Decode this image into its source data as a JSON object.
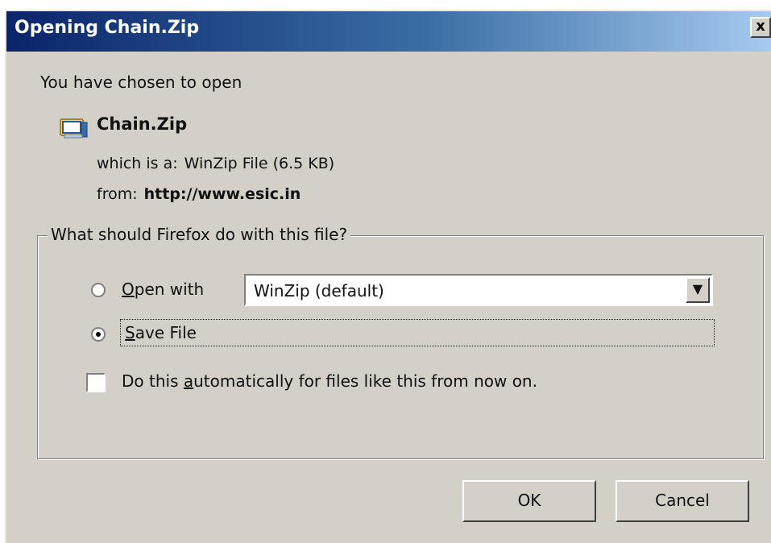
{
  "window": {
    "title": "Opening Chain.Zip",
    "close_label": "x"
  },
  "intro_text": "You have chosen to open",
  "file": {
    "icon": "winzip-file-icon",
    "name": "Chain.Zip",
    "type_label": "which is a:",
    "type_value": "WinZip File (6.5 KB)",
    "from_label": "from:",
    "from_value": "http://www.esic.in"
  },
  "action_group": {
    "legend": "What should Firefox do with this file?",
    "open_with": {
      "mnemonic": "O",
      "rest": "pen with",
      "checked": false
    },
    "open_with_app": "WinZip (default)",
    "save_file": {
      "mnemonic": "S",
      "rest": "ave File",
      "checked": true
    },
    "auto": {
      "before": "Do this ",
      "mnemonic": "a",
      "after": "utomatically for files like this from now on.",
      "checked": false
    }
  },
  "buttons": {
    "ok": "OK",
    "cancel": "Cancel"
  },
  "colors": {
    "title_bar_start": "#0a246a",
    "title_bar_end": "#a6caf0",
    "dialog_bg": "#d4d0c8"
  }
}
